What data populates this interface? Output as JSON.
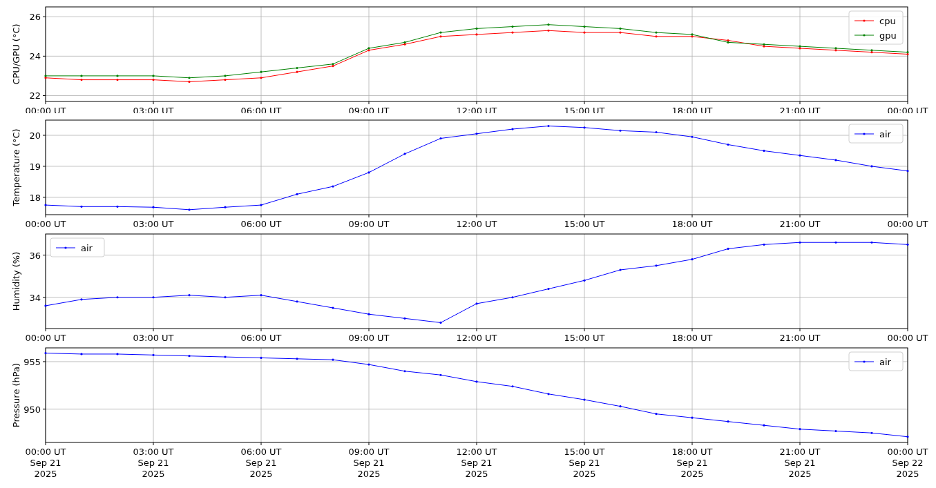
{
  "panels": [
    {
      "chart_data": {
        "type": "line",
        "ylabel": "CPU/GPU (°C)",
        "grid": true,
        "legend": "upper right",
        "categories": [
          "00:00 UT",
          null,
          null,
          "03:00 UT",
          null,
          null,
          "06:00 UT",
          null,
          null,
          "09:00 UT",
          null,
          null,
          "12:00 UT",
          null,
          null,
          "15:00 UT",
          null,
          null,
          "18:00 UT",
          null,
          null,
          "21:00 UT",
          null,
          null,
          "00:00 UT"
        ],
        "series": [
          {
            "name": "cpu",
            "color": "#ff0000",
            "values": [
              22.9,
              22.8,
              22.8,
              22.8,
              22.7,
              22.8,
              22.9,
              23.2,
              23.5,
              24.3,
              24.6,
              25.0,
              25.1,
              25.2,
              25.3,
              25.2,
              25.2,
              25.0,
              25.0,
              24.8,
              24.5,
              24.4,
              24.3,
              24.2,
              24.1
            ]
          },
          {
            "name": "gpu",
            "color": "#008000",
            "values": [
              23.0,
              23.0,
              23.0,
              23.0,
              22.9,
              23.0,
              23.2,
              23.4,
              23.6,
              24.4,
              24.7,
              25.2,
              25.4,
              25.5,
              25.6,
              25.5,
              25.4,
              25.2,
              25.1,
              24.7,
              24.6,
              24.5,
              24.4,
              24.3,
              24.2
            ]
          }
        ],
        "ylim": [
          21.7,
          26.5
        ],
        "yticks": [
          22,
          24,
          26
        ]
      }
    },
    {
      "chart_data": {
        "type": "line",
        "ylabel": "Temperature (°C)",
        "grid": true,
        "legend": "upper right",
        "categories": [
          "00:00 UT",
          null,
          null,
          "03:00 UT",
          null,
          null,
          "06:00 UT",
          null,
          null,
          "09:00 UT",
          null,
          null,
          "12:00 UT",
          null,
          null,
          "15:00 UT",
          null,
          null,
          "18:00 UT",
          null,
          null,
          "21:00 UT",
          null,
          null,
          "00:00 UT"
        ],
        "series": [
          {
            "name": "air",
            "color": "#0000ff",
            "values": [
              17.75,
              17.7,
              17.7,
              17.68,
              17.6,
              17.68,
              17.75,
              18.1,
              18.35,
              18.8,
              19.4,
              19.9,
              20.05,
              20.2,
              20.3,
              20.25,
              20.15,
              20.1,
              19.95,
              19.7,
              19.5,
              19.35,
              19.2,
              19.0,
              18.85
            ]
          }
        ],
        "ylim": [
          17.44,
          20.49
        ],
        "yticks": [
          18,
          19,
          20
        ]
      }
    },
    {
      "chart_data": {
        "type": "line",
        "ylabel": "Humidity (%)",
        "grid": true,
        "legend": "upper left",
        "categories": [
          "00:00 UT",
          null,
          null,
          "03:00 UT",
          null,
          null,
          "06:00 UT",
          null,
          null,
          "09:00 UT",
          null,
          null,
          "12:00 UT",
          null,
          null,
          "15:00 UT",
          null,
          null,
          "18:00 UT",
          null,
          null,
          "21:00 UT",
          null,
          null,
          "00:00 UT"
        ],
        "series": [
          {
            "name": "air",
            "color": "#0000ff",
            "values": [
              33.6,
              33.9,
              34.0,
              34.0,
              34.1,
              34.0,
              34.1,
              33.8,
              33.5,
              33.2,
              33.0,
              32.8,
              33.7,
              34.0,
              34.4,
              34.8,
              35.3,
              35.5,
              35.8,
              36.3,
              36.5,
              36.6,
              36.6,
              36.6,
              36.5
            ]
          }
        ],
        "ylim": [
          32.52,
          37.0
        ],
        "yticks": [
          34,
          36
        ]
      }
    },
    {
      "chart_data": {
        "type": "line",
        "ylabel": "Pressure (hPa)",
        "grid": true,
        "legend": "upper right",
        "categories": [
          "00:00 UT\nSep 21\n2025",
          null,
          null,
          "03:00 UT\nSep 21\n2025",
          null,
          null,
          "06:00 UT\nSep 21\n2025",
          null,
          null,
          "09:00 UT\nSep 21\n2025",
          null,
          null,
          "12:00 UT\nSep 21\n2025",
          null,
          null,
          "15:00 UT\nSep 21\n2025",
          null,
          null,
          "18:00 UT\nSep 21\n2025",
          null,
          null,
          "21:00 UT\nSep 21\n2025",
          null,
          null,
          "00:00 UT\nSep 22\n2025"
        ],
        "series": [
          {
            "name": "air",
            "color": "#0000ff",
            "values": [
              955.9,
              955.8,
              955.8,
              955.7,
              955.6,
              955.5,
              955.4,
              955.3,
              955.2,
              954.7,
              954.0,
              953.6,
              952.9,
              952.4,
              951.6,
              951.0,
              950.3,
              949.5,
              949.1,
              948.7,
              948.3,
              947.9,
              947.7,
              947.5,
              947.1
            ]
          }
        ],
        "ylim": [
          946.5,
          956.45
        ],
        "yticks": [
          950,
          955
        ]
      }
    }
  ]
}
